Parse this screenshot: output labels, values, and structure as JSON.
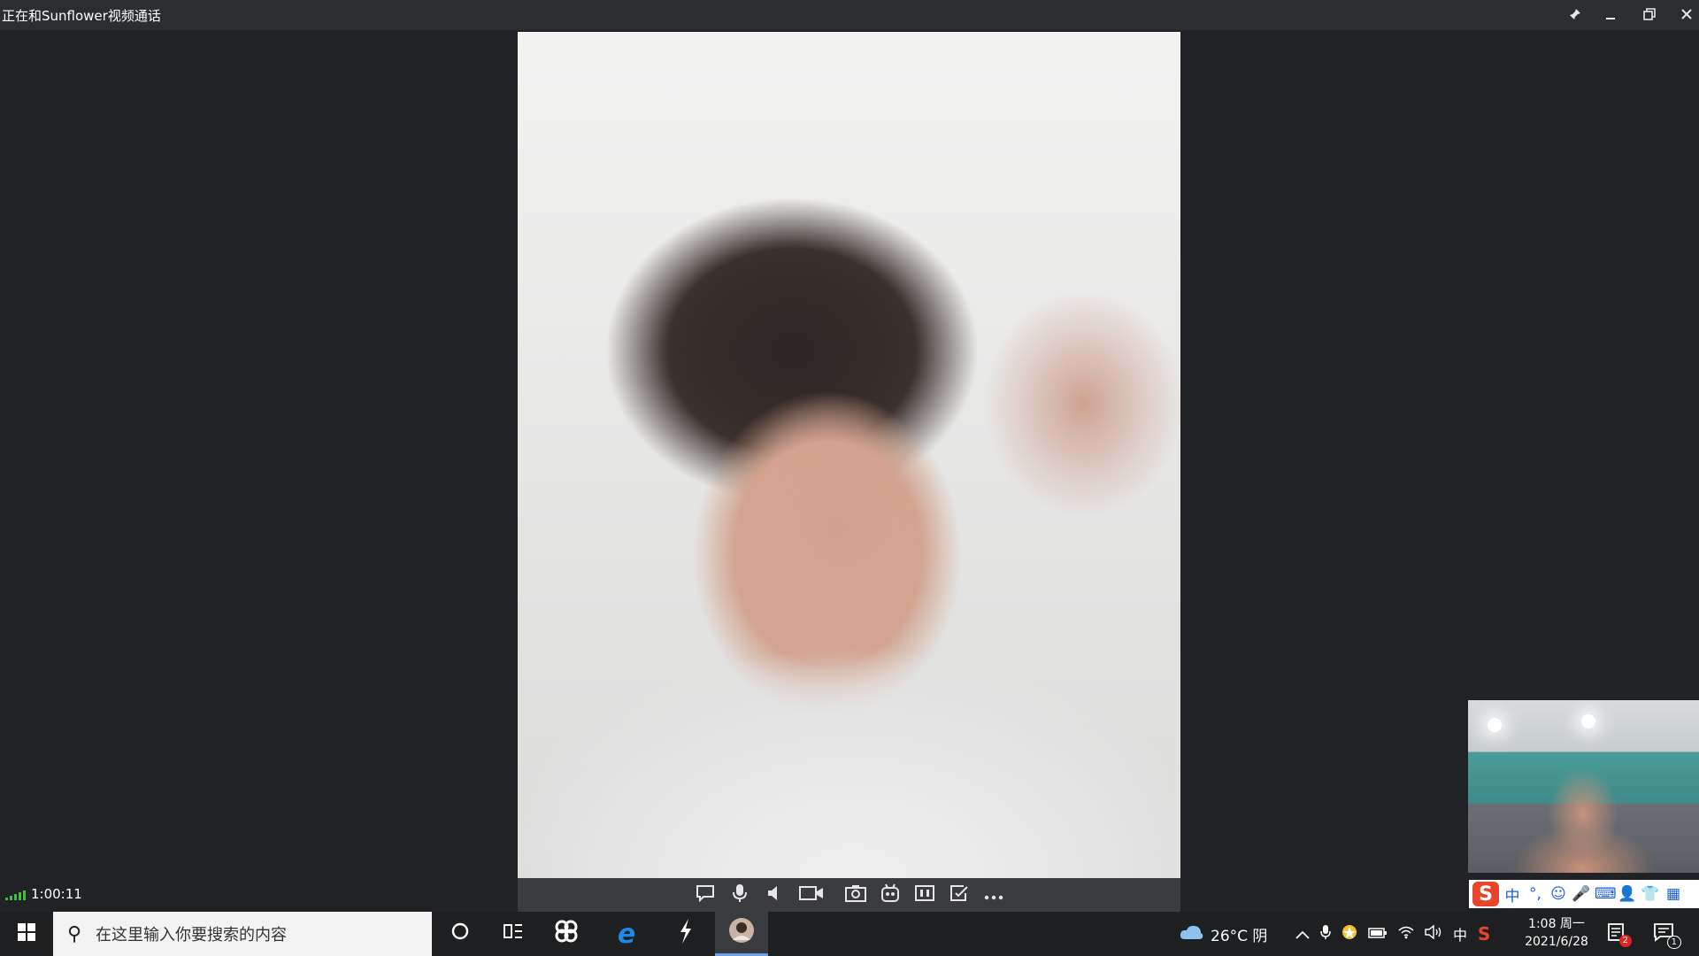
{
  "window": {
    "title": "正在和Sunflower视频通话",
    "pin_icon": "pin-icon",
    "minimize_icon": "minimize-icon",
    "restore_icon": "restore-icon",
    "close_icon": "close-icon"
  },
  "call": {
    "duration": "1:00:11",
    "controls": [
      {
        "name": "chat-button",
        "icon": "chat-bubble-icon"
      },
      {
        "name": "microphone-button",
        "icon": "microphone-icon"
      },
      {
        "name": "speaker-button",
        "icon": "speaker-icon"
      },
      {
        "name": "camera-button",
        "icon": "video-camera-icon"
      },
      {
        "name": "screenshot-button",
        "icon": "camera-icon"
      },
      {
        "name": "effects-button",
        "icon": "robot-face-icon"
      },
      {
        "name": "layout-button",
        "icon": "split-screen-icon"
      },
      {
        "name": "whiteboard-button",
        "icon": "edit-box-icon"
      },
      {
        "name": "more-button",
        "icon": "more-dots-icon"
      }
    ]
  },
  "ime": {
    "logo": "S",
    "items": [
      "中",
      "°,",
      "☺",
      "🎤",
      "⌨",
      "👤",
      "👕",
      "▦"
    ]
  },
  "taskbar": {
    "search_placeholder": "在这里输入你要搜索的内容",
    "weather": "26°C 阴",
    "tray_ime": "中",
    "time": "1:08 周一",
    "date": "2021/6/28",
    "notification_count": "2",
    "action_center_count": "1"
  }
}
